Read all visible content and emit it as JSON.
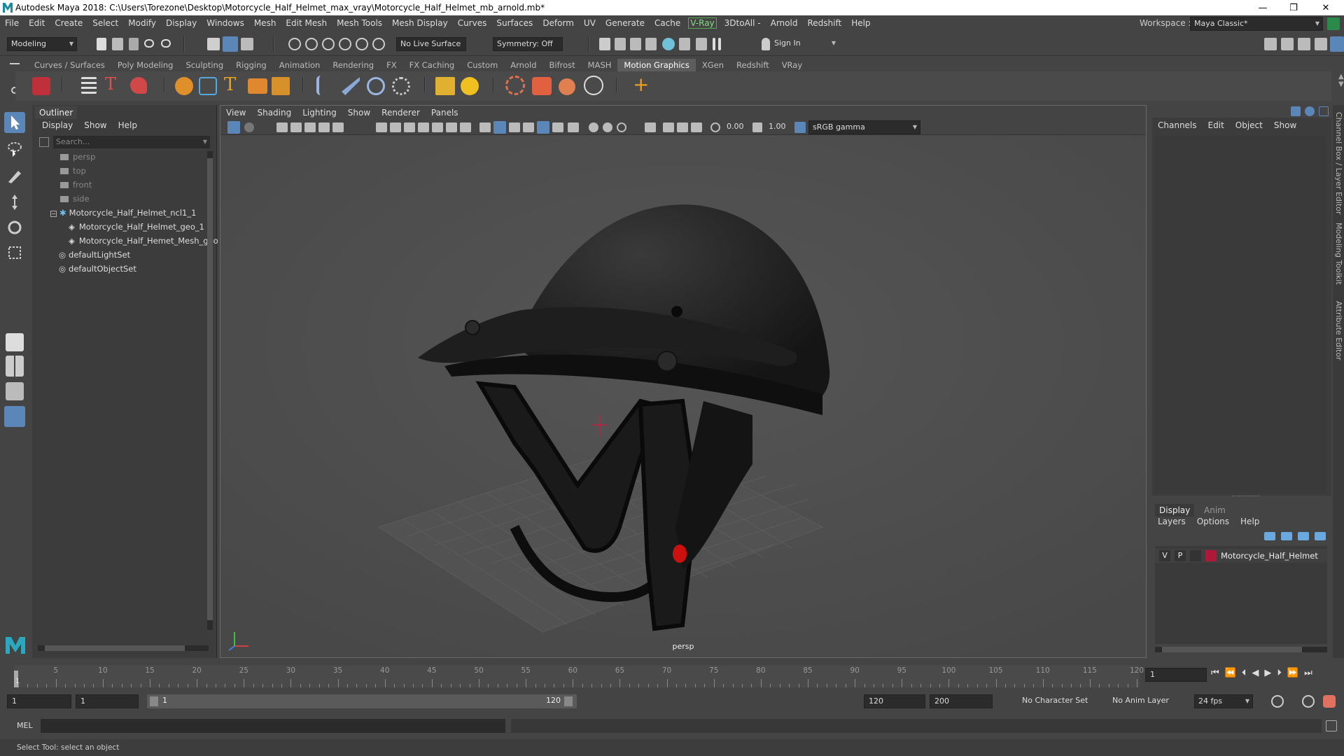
{
  "window": {
    "title": "Autodesk Maya 2018: C:\\Users\\Torezone\\Desktop\\Motorcycle_Half_Helmet_max_vray\\Motorcycle_Half_Helmet_mb_arnold.mb*",
    "minimize": "—",
    "restore": "❐",
    "close": "✕"
  },
  "menubar": {
    "items": [
      "File",
      "Edit",
      "Create",
      "Select",
      "Modify",
      "Display",
      "Windows",
      "Mesh",
      "Edit Mesh",
      "Mesh Tools",
      "Mesh Display",
      "Curves",
      "Surfaces",
      "Deform",
      "UV",
      "Generate",
      "Cache"
    ],
    "vray": "V-Ray",
    "items2": [
      "3DtoAll -",
      "Arnold",
      "Redshift",
      "Help"
    ],
    "workspace_label": "Workspace :",
    "workspace_value": "Maya Classic*"
  },
  "statusline": {
    "mode": "Modeling",
    "live_surface": "No Live Surface",
    "symmetry": "Symmetry: Off",
    "sign_in": "Sign In"
  },
  "shelf": {
    "tabs": [
      "Curves / Surfaces",
      "Poly Modeling",
      "Sculpting",
      "Rigging",
      "Animation",
      "Rendering",
      "FX",
      "FX Caching",
      "Custom",
      "Arnold",
      "Bifrost",
      "MASH",
      "Motion Graphics",
      "XGen",
      "Redshift",
      "VRay"
    ],
    "active_tab": "Motion Graphics"
  },
  "outliner": {
    "title": "Outliner",
    "menu": [
      "Display",
      "Show",
      "Help"
    ],
    "search_placeholder": "Search...",
    "items": [
      {
        "label": "persp"
      },
      {
        "label": "top"
      },
      {
        "label": "front"
      },
      {
        "label": "side"
      },
      {
        "label": "Motorcycle_Half_Helmet_ncl1_1"
      },
      {
        "label": "Motorcycle_Half_Helmet_geo_1"
      },
      {
        "label": "Motorcycle_Half_Hemet_Mesh_geo"
      },
      {
        "label": "defaultLightSet"
      },
      {
        "label": "defaultObjectSet"
      }
    ]
  },
  "viewport": {
    "menu": [
      "View",
      "Shading",
      "Lighting",
      "Show",
      "Renderer",
      "Panels"
    ],
    "exposure": "0.00",
    "gamma": "1.00",
    "color_space": "sRGB gamma",
    "camera_label": "persp"
  },
  "channelbox": {
    "menu": [
      "Channels",
      "Edit",
      "Object",
      "Show"
    ],
    "side_tabs": [
      "Channel Box / Layer Editor",
      "Modeling Toolkit",
      "Attribute Editor"
    ]
  },
  "layers": {
    "tabs": [
      "Display",
      "Anim"
    ],
    "active_tab": "Display",
    "menu": [
      "Layers",
      "Options",
      "Help"
    ],
    "layer": {
      "v": "V",
      "p": "P",
      "name": "Motorcycle_Half_Helmet",
      "color": "#b0183a"
    }
  },
  "timeslider": {
    "ticks": [
      "5",
      "10",
      "15",
      "20",
      "25",
      "30",
      "35",
      "40",
      "45",
      "50",
      "55",
      "60",
      "65",
      "70",
      "75",
      "80",
      "85",
      "90",
      "95",
      "100",
      "105",
      "110",
      "115",
      "120"
    ],
    "current_start": "1",
    "current_frame": "1"
  },
  "range": {
    "start": "1",
    "playback_start": "1",
    "slider_start": "1",
    "slider_end": "120",
    "playback_end": "120",
    "end": "200",
    "character_set": "No Character Set",
    "anim_layer": "No Anim Layer",
    "fps": "24 fps"
  },
  "cmdline": {
    "label": "MEL"
  },
  "helpline": {
    "text": "Select Tool: select an object"
  }
}
